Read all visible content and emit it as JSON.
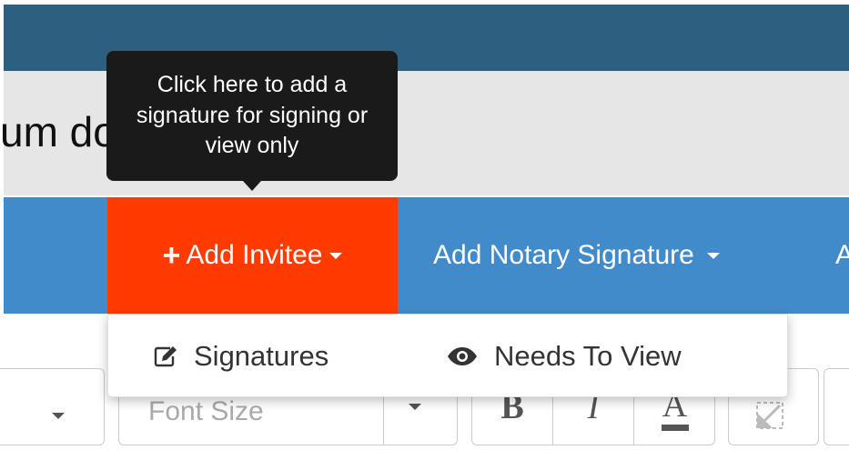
{
  "document": {
    "title": "um dolor sit amet"
  },
  "tooltip": {
    "text": "Click here to add a signature for signing or view only"
  },
  "nav": {
    "add_invitee_plus": "+",
    "add_invitee_label": "Add Invitee",
    "add_notary_label": "Add Notary Signature",
    "partial_label": "A"
  },
  "dropdown": {
    "items": [
      {
        "label": "Signatures",
        "icon": "edit-icon"
      },
      {
        "label": "Needs To View",
        "icon": "eye-icon"
      }
    ]
  },
  "toolbar": {
    "font_size_placeholder": "Font Size",
    "bold_label": "B",
    "italic_label": "I",
    "font_color_label": "A"
  },
  "colors": {
    "header": "#2c5f80",
    "nav": "#428bca",
    "active_nav": "#ff3b00",
    "tooltip": "#1a1a1a",
    "title_band": "#e6e6e6"
  }
}
